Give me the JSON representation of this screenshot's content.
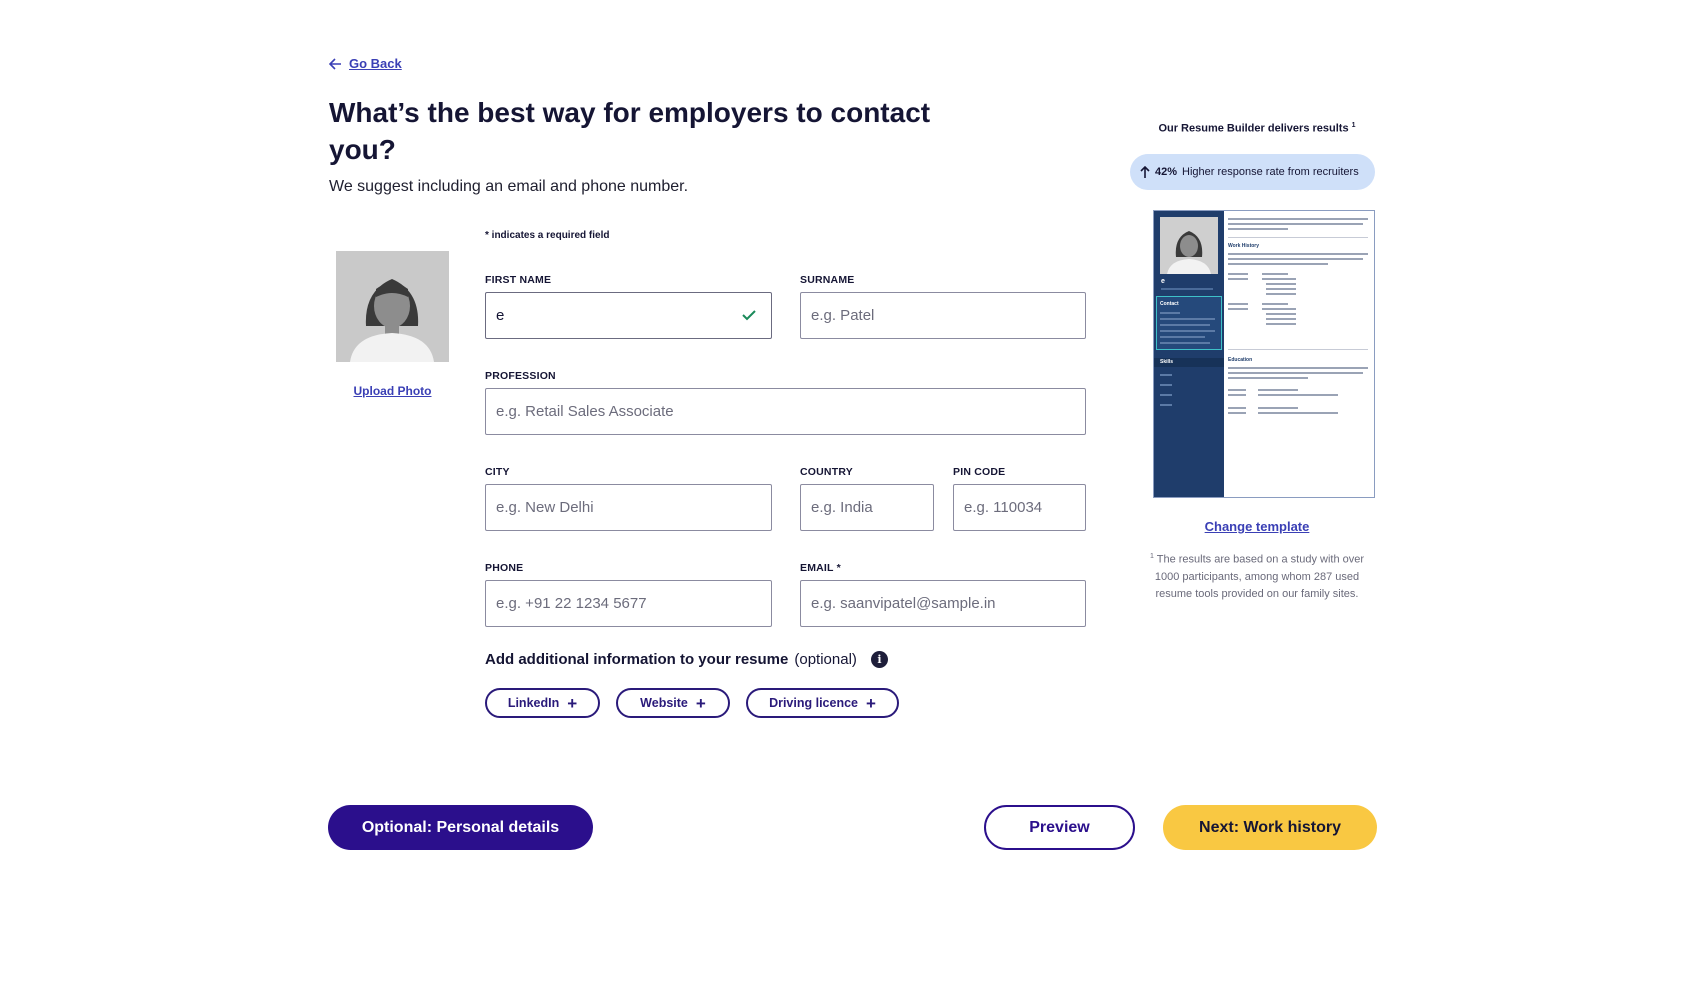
{
  "nav": {
    "go_back_label": "Go Back"
  },
  "header": {
    "title": "What’s the best way for employers to contact you?",
    "subtitle": "We suggest including an email and phone number."
  },
  "photo": {
    "upload_label": "Upload Photo"
  },
  "form": {
    "required_note": "* indicates a required field",
    "first_name": {
      "label": "FIRST NAME",
      "value": "e",
      "placeholder": ""
    },
    "surname": {
      "label": "SURNAME",
      "placeholder": "e.g. Patel"
    },
    "profession": {
      "label": "PROFESSION",
      "placeholder": "e.g. Retail Sales Associate"
    },
    "city": {
      "label": "CITY",
      "placeholder": "e.g. New Delhi"
    },
    "country": {
      "label": "COUNTRY",
      "placeholder": "e.g. India"
    },
    "pin_code": {
      "label": "PIN CODE",
      "placeholder": "e.g. 110034"
    },
    "phone": {
      "label": "PHONE",
      "placeholder": "e.g. +91 22 1234 5677"
    },
    "email": {
      "label": "EMAIL *",
      "placeholder": "e.g. saanvipatel@sample.in"
    }
  },
  "additional": {
    "heading": "Add additional information to your resume",
    "optional": "(optional)",
    "info_icon": "i",
    "chips": [
      {
        "label": "LinkedIn",
        "icon": "plus-icon"
      },
      {
        "label": "Website",
        "icon": "plus-icon"
      },
      {
        "label": "Driving licence",
        "icon": "plus-icon"
      }
    ]
  },
  "footer_buttons": {
    "optional_label": "Optional: Personal details",
    "preview_label": "Preview",
    "next_label": "Next: Work history"
  },
  "sidebar": {
    "title": "Our Resume Builder delivers results",
    "title_sup": "1",
    "stat_value": "42%",
    "stat_text": "Higher response rate from recruiters",
    "resume_preview": {
      "name": "e",
      "contact_heading": "Contact",
      "skills_heading": "Skills",
      "work_heading": "Work History",
      "education_heading": "Education"
    },
    "change_template_label": "Change template",
    "footnote_sup": "1",
    "footnote": "The results are based on a study with over 1000 participants, among whom 287 used resume tools provided on our family sites."
  },
  "colors": {
    "primary": "#2b0f8c",
    "accent_yellow": "#f9c842",
    "link": "#3a3fb5",
    "success_check": "#1a8a5a",
    "stat_pill_bg": "#cfe0f9",
    "resume_sidebar": "#1f3d6b"
  }
}
